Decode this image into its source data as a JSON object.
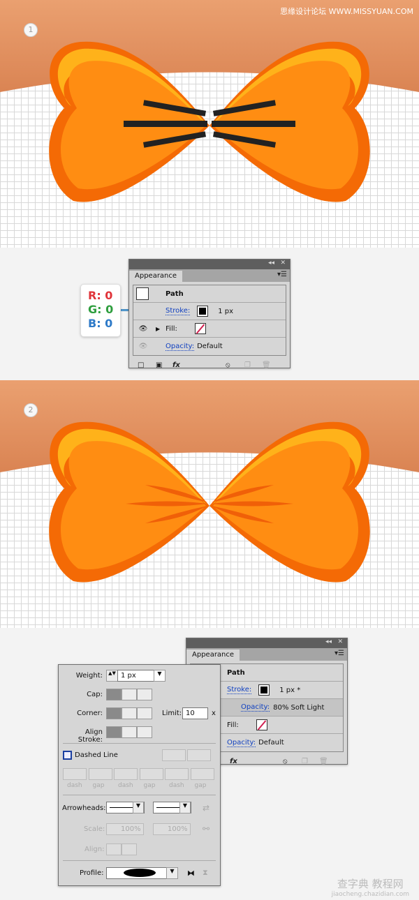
{
  "watermark_top": "思缘设计论坛 WWW.MISSYUAN.COM",
  "watermark_bottom": {
    "line1": "查字典 教程网",
    "line2": "jiaocheng.chazidian.com"
  },
  "steps": [
    {
      "number": "1"
    },
    {
      "number": "2"
    }
  ],
  "colors": {
    "bow_orange": "#ff8a10",
    "bow_dark": "#f46a05",
    "bow_highlight": "#ffb21a",
    "band": "#e39560",
    "stroke_lines": "#222222"
  },
  "rgb_callout": {
    "r": "R: 0",
    "g": "G: 0",
    "b": "B: 0"
  },
  "appearance1": {
    "tab": "Appearance",
    "path": "Path",
    "stroke_label": "Stroke:",
    "stroke_value": "1 px",
    "fill_label": "Fill:",
    "opacity_label": "Opacity:",
    "opacity_value": "Default",
    "fx": "fx"
  },
  "appearance2": {
    "tab": "Appearance",
    "path": "Path",
    "stroke_label": "Stroke:",
    "stroke_value": "1 px *",
    "sub_opacity_label": "Opacity:",
    "sub_opacity_value": "80% Soft Light",
    "fill_label": "Fill:",
    "opacity_label": "Opacity:",
    "opacity_value": "Default",
    "fx": "fx"
  },
  "stroke_panel": {
    "weight_label": "Weight:",
    "weight_value": "1 px",
    "cap_label": "Cap:",
    "corner_label": "Corner:",
    "limit_label": "Limit:",
    "limit_value": "10",
    "limit_unit": "x",
    "align_label": "Align Stroke:",
    "dashed_label": "Dashed Line",
    "dashed_checked": false,
    "dash_labels": [
      "dash",
      "gap",
      "dash",
      "gap",
      "dash",
      "gap"
    ],
    "arrowheads_label": "Arrowheads:",
    "scale_label": "Scale:",
    "scale_start": "100%",
    "scale_end": "100%",
    "align_arrows_label": "Align:",
    "profile_label": "Profile:"
  }
}
